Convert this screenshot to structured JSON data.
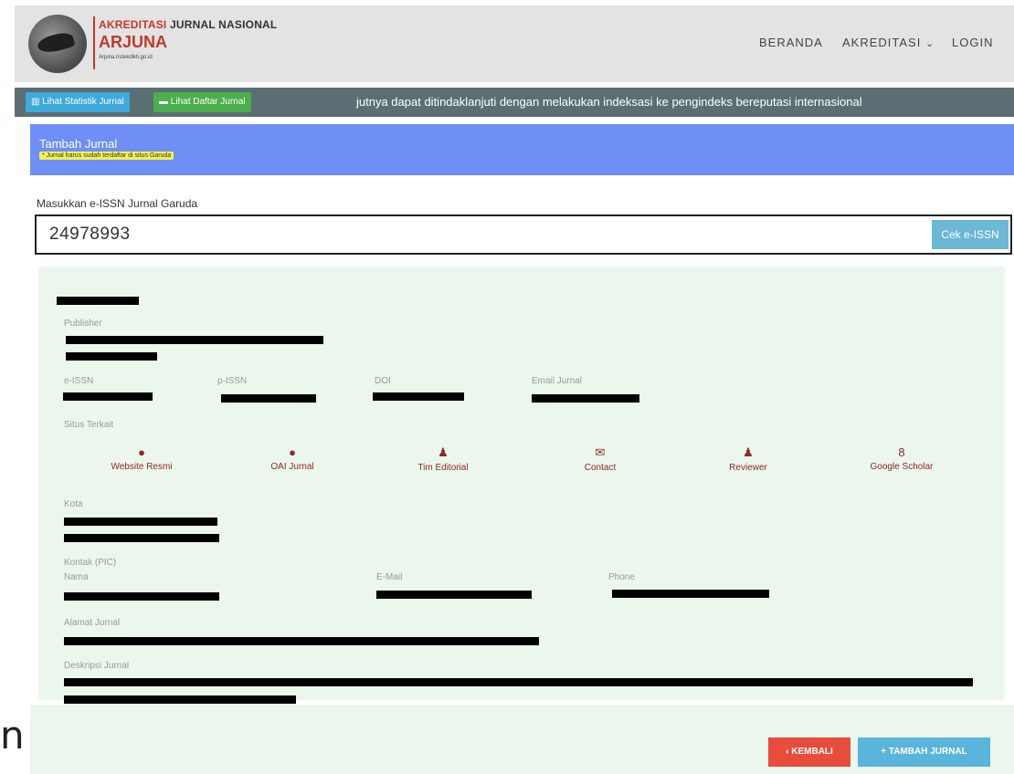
{
  "logo": {
    "line1_red": "AKREDITASI",
    "line1_dark": "JURNAL NASIONAL",
    "line2": "ARJUNA",
    "line3": "Arjuna.ristekdikti.go.id"
  },
  "nav": {
    "beranda": "BERANDA",
    "akreditasi": "AKREDITASI",
    "akreditasi_caret": "⌄",
    "login": "LOGIN"
  },
  "toolbar": {
    "statistik": "Lihat Statistik Jurnal",
    "daftar": "Lihat Daftar Jurnal",
    "marquee": "jutnya dapat ditindaklanjuti dengan melakukan indeksasi ke pengindeks bereputasi internasional"
  },
  "header": {
    "title": "Tambah Jurnal",
    "note": "* Jurnal harus sudah terdaftar di situs Garuda"
  },
  "issn": {
    "label": "Masukkan e-ISSN Jurnal Garuda",
    "value": "24978993",
    "check_button": "Cek e-ISSN"
  },
  "journal": {
    "publisher_label": "Publisher",
    "eissn_label": "e-ISSN",
    "pissn_label": "p-ISSN",
    "doi_label": "DOI",
    "email_label": "Email Jurnal",
    "situs_label": "Situs Terkait",
    "links": [
      {
        "label": "Website Resmi",
        "icon": "globe-icon",
        "glyph": "●"
      },
      {
        "label": "OAI Jurnal",
        "icon": "globe-icon",
        "glyph": "●"
      },
      {
        "label": "Tim Editorial",
        "icon": "users-icon",
        "glyph": "♟"
      },
      {
        "label": "Contact",
        "icon": "envelope-icon",
        "glyph": "✉"
      },
      {
        "label": "Reviewer",
        "icon": "user-icon",
        "glyph": "♟"
      },
      {
        "label": "Google Scholar",
        "icon": "google-icon",
        "glyph": "8"
      }
    ],
    "kota_label": "Kota",
    "kontak_label": "Kontak (PIC)",
    "nama_label": "Nama",
    "email_pic_label": "E-Mail",
    "phone_label": "Phone",
    "alamat_label": "Alamat Jurnal",
    "deskripsi_label": "Deskripsi Jurnal"
  },
  "actions": {
    "back": "‹ KEMBALI",
    "add": "+ TAMBAH JURNAL"
  },
  "edge_char": "n",
  "colors": {
    "accent_blue": "#6f8ff7",
    "panel_green": "#ebf6ec",
    "danger": "#e74c3c",
    "info": "#5ab5dc"
  }
}
